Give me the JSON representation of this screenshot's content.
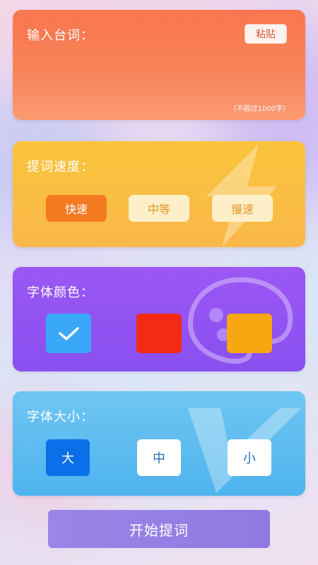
{
  "input_card": {
    "title": "输入台词：",
    "paste_label": "粘贴",
    "hint": "（不超过1000字）",
    "text_value": ""
  },
  "speed_card": {
    "title": "提词速度：",
    "options": [
      "快速",
      "中等",
      "慢速"
    ],
    "selected": "快速"
  },
  "color_card": {
    "title": "字体颜色：",
    "swatches": [
      "#3aa8f8",
      "#f32a14",
      "#f7a710"
    ],
    "selected_index": 0
  },
  "size_card": {
    "title": "字体大小：",
    "options": [
      "大",
      "中",
      "小"
    ],
    "selected": "大"
  },
  "start_label": "开始提词",
  "colors": {
    "input_bg": "#f9774f",
    "speed_bg": "#fbc43c",
    "color_bg": "#9b57f4",
    "size_bg": "#6ec6f2",
    "start_bg": "#9a86e6"
  },
  "icons": [
    "lightning-icon",
    "palette-icon",
    "v-logo-icon",
    "check-icon"
  ]
}
